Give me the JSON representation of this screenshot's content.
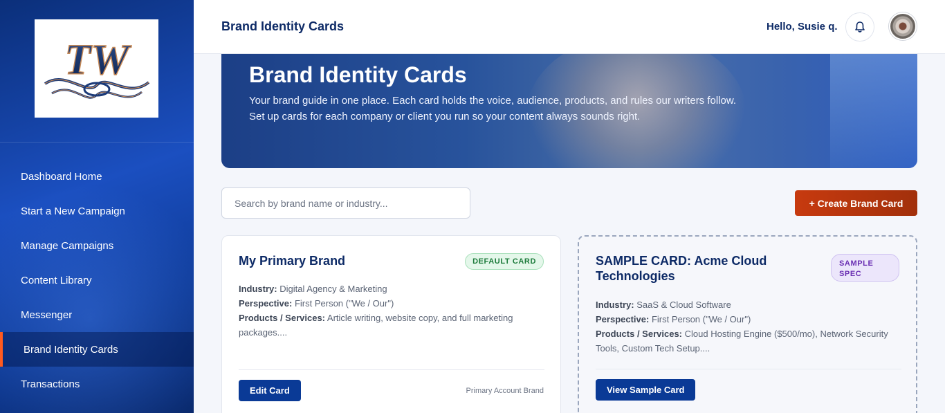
{
  "sidebar": {
    "logo_text": "TW",
    "items": [
      {
        "label": "Dashboard Home"
      },
      {
        "label": "Start a New Campaign"
      },
      {
        "label": "Manage Campaigns"
      },
      {
        "label": "Content Library"
      },
      {
        "label": "Messenger"
      },
      {
        "label": "Brand Identity Cards",
        "active": true
      },
      {
        "label": "Transactions"
      }
    ]
  },
  "header": {
    "title": "Brand Identity Cards",
    "greeting": "Hello, Susie q.",
    "bell_icon": "bell-icon"
  },
  "hero": {
    "title": "Brand Identity Cards",
    "description": "Your brand guide in one place. Each card holds the voice, audience, products, and rules our writers follow. Set up cards for each company or client you run so your content always sounds right."
  },
  "toolbar": {
    "search_placeholder": "Search by brand name or industry...",
    "create_label": "+ Create Brand Card"
  },
  "cards": [
    {
      "title": "My Primary Brand",
      "badge": "DEFAULT CARD",
      "industry_label": "Industry:",
      "industry": "Digital Agency & Marketing",
      "perspective_label": "Perspective:",
      "perspective": "First Person (\"We / Our\")",
      "products_label": "Products / Services:",
      "products": "Article writing, website copy, and full marketing packages....",
      "button": "Edit Card",
      "meta": "Primary Account Brand"
    },
    {
      "title": "SAMPLE CARD: Acme Cloud Technologies",
      "badge": "SAMPLE SPEC",
      "industry_label": "Industry:",
      "industry": "SaaS & Cloud Software",
      "perspective_label": "Perspective:",
      "perspective": "First Person (\"We / Our\")",
      "products_label": "Products / Services:",
      "products": "Cloud Hosting Engine ($500/mo), Network Security Tools, Custom Tech Setup....",
      "button": "View Sample Card"
    }
  ],
  "colors": {
    "accent": "#c73a0f",
    "primary": "#0a3a96",
    "heading": "#0d2a66"
  }
}
